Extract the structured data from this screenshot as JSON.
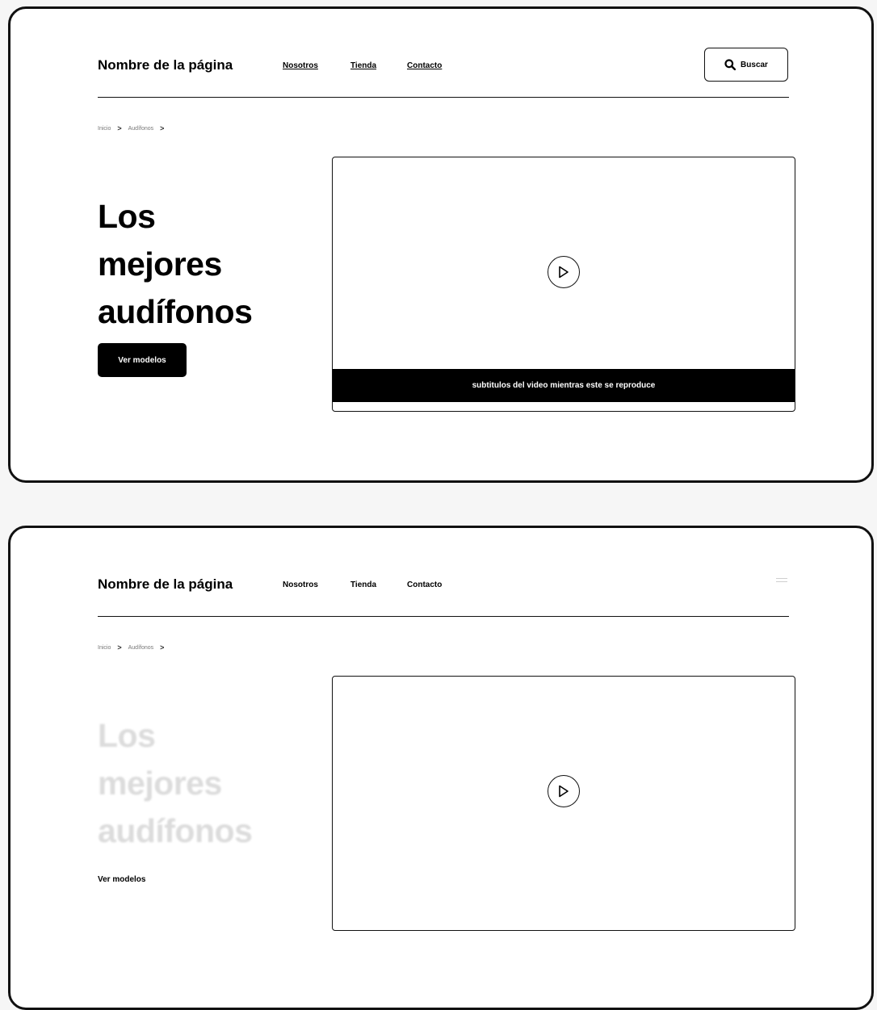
{
  "header": {
    "brand": "Nombre de la página",
    "nav": [
      "Nosotros",
      "Tienda",
      "Contacto"
    ],
    "search_label": "Buscar"
  },
  "breadcrumb": {
    "items": [
      "Inicio",
      "Audífonos"
    ],
    "separator": ">"
  },
  "hero": {
    "title_lines": [
      "Los",
      "mejores",
      "audífonos"
    ],
    "cta_label": "Ver modelos"
  },
  "video": {
    "subtitle": "subtitulos del video mientras este se reproduce"
  },
  "icons": {
    "search": "search-icon",
    "play": "play-icon",
    "menu": "menu-icon"
  },
  "colors": {
    "frame_border": "#111111",
    "button_bg": "#000000",
    "button_text": "#ffffff",
    "faded_title": "#d6d6d6"
  }
}
